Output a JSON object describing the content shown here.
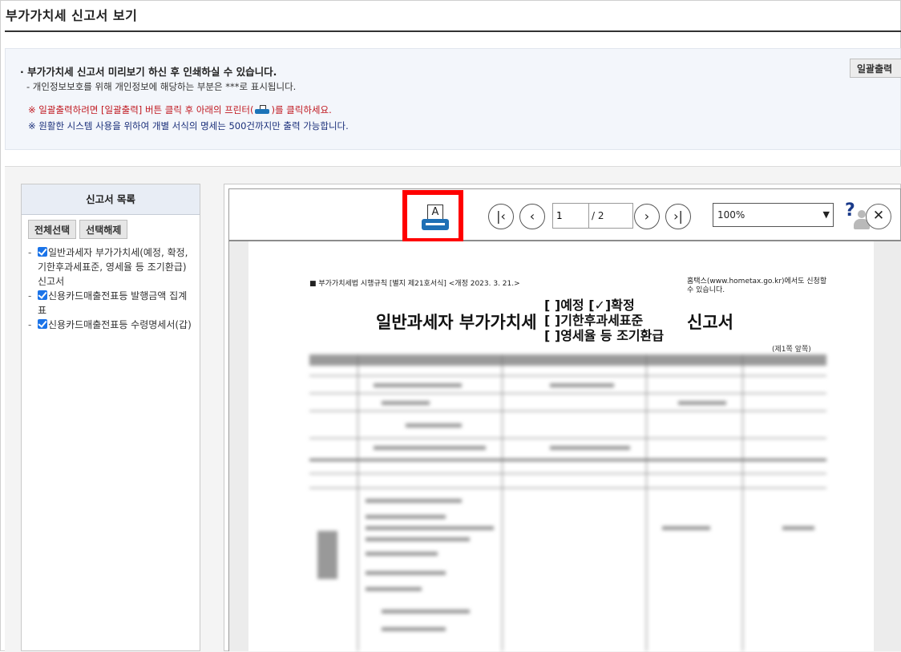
{
  "window": {
    "title": "부가가치세 신고서 보기"
  },
  "notice": {
    "line1": "· 부가가치세 신고서 미리보기 하신 후 인쇄하실 수 있습니다.",
    "line2": "- 개인정보보호를 위해 개인정보에 해당하는 부분은  ***로 표시됩니다.",
    "line3_prefix": "※ 일괄출력하려면 [일괄출력] 버튼 클릭 후 아래의 프린터(",
    "line3_suffix": ")를 클릭하세요.",
    "line4": "※ 원활한 시스템 사용을 위하여 개별 서식의 명세는 500건까지만 출력 가능합니다.",
    "batch_button": "일괄출력",
    "printer_icon": "printer-icon"
  },
  "sidebar": {
    "header": "신고서 목록",
    "select_all": "전체선택",
    "deselect": "선택해제",
    "items": [
      {
        "label": "일반과세자 부가가치세(예정, 확정, 기한후과세표준, 영세율 등 조기환급)신고서",
        "checked": true
      },
      {
        "label": "신용카드매출전표등 발행금액 집계표",
        "checked": true
      },
      {
        "label": "신용카드매출전표등 수령명세서(갑)",
        "checked": true
      }
    ]
  },
  "viewer": {
    "print_icon": "printer-icon",
    "page_current": "1",
    "page_total": "/ 2",
    "zoom": "100%",
    "help": "?",
    "highlight_color": "#ff0000"
  },
  "document": {
    "law_line": "■ 부가가치세법 시행규칙 [별지 제21호서식] <개정 2023. 3. 21.>",
    "note": "홈택스(www.hometax.go.kr)에서도 신청할 수 있습니다.",
    "title_left": "일반과세자 부가가치세",
    "options": [
      "[  ]예정  [✓]확정",
      "[  ]기한후과세표준",
      "[  ]영세율 등 조기환급"
    ],
    "title_right": "신고서",
    "page_note": "(제1쪽 앞쪽)"
  }
}
